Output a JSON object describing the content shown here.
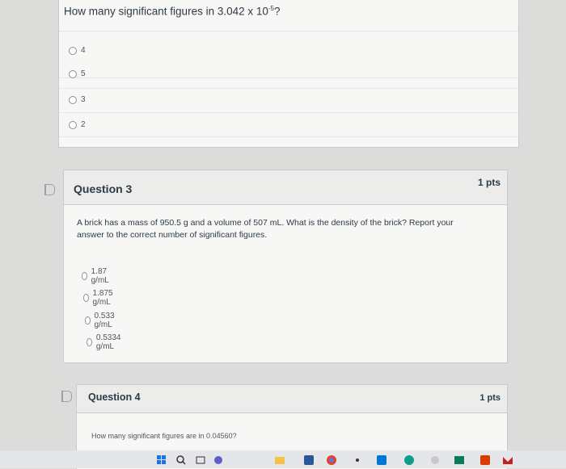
{
  "question2": {
    "text_prefix": "How many significant figures in 3.042 x 10",
    "exponent": "-5",
    "text_suffix": "?",
    "answers": [
      "4",
      "5",
      "3",
      "2"
    ]
  },
  "question3": {
    "title": "Question 3",
    "points": "1 pts",
    "body_line1": "A brick has a mass of 950.5 g and a volume of 507 mL. What is the density of the brick? Report your",
    "body_line2": "answer to the correct number of significant figures.",
    "answers": [
      "1.87 g/mL",
      "1.875 g/mL",
      "0.533 g/mL",
      "0.5334 g/mL"
    ]
  },
  "question4": {
    "title": "Question 4",
    "points": "1 pts",
    "body": "How many significant figures are in 0.04560?"
  },
  "taskbar": {
    "icons": [
      "windows-start-icon",
      "search-icon",
      "task-view-icon",
      "chat-icon",
      "file-explorer-icon",
      "app-icon",
      "chrome-icon",
      "app-icon",
      "photos-icon",
      "edge-icon",
      "store-icon",
      "app-icon",
      "office-icon",
      "mail-icon"
    ],
    "accent": "#1a73e8"
  }
}
